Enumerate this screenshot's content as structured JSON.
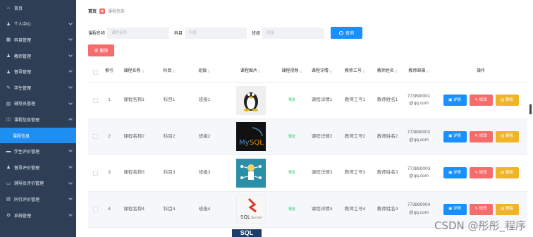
{
  "sidebar": {
    "items": [
      {
        "label": "首页",
        "icon": "home-icon",
        "glyph": "⌂",
        "has_chevron": false,
        "state": "normal"
      },
      {
        "label": "个人中心",
        "icon": "user-icon",
        "glyph": "♟",
        "has_chevron": true,
        "state": "normal"
      },
      {
        "label": "科目管理",
        "icon": "grid-icon",
        "glyph": "▦",
        "has_chevron": true,
        "state": "normal"
      },
      {
        "label": "教师管理",
        "icon": "person-icon",
        "glyph": "♟",
        "has_chevron": true,
        "state": "normal"
      },
      {
        "label": "督导管理",
        "icon": "person-icon",
        "glyph": "♟",
        "has_chevron": true,
        "state": "normal"
      },
      {
        "label": "学生管理",
        "icon": "student-icon",
        "glyph": "✎",
        "has_chevron": true,
        "state": "normal"
      },
      {
        "label": "辅导员管理",
        "icon": "book-icon",
        "glyph": "▤",
        "has_chevron": true,
        "state": "normal"
      },
      {
        "label": "课程信息管理",
        "icon": "folder-icon",
        "glyph": "◫",
        "has_chevron": true,
        "state": "open"
      },
      {
        "label": "课程信息",
        "icon": "",
        "glyph": "",
        "has_chevron": false,
        "state": "active"
      },
      {
        "label": "学生评价管理",
        "icon": "comment-icon",
        "glyph": "▬",
        "has_chevron": true,
        "state": "normal"
      },
      {
        "label": "督导评价管理",
        "icon": "person-icon",
        "glyph": "♟",
        "has_chevron": true,
        "state": "normal"
      },
      {
        "label": "辅导员评价管理",
        "icon": "message-icon",
        "glyph": "▭",
        "has_chevron": true,
        "state": "normal"
      },
      {
        "label": "同行评价管理",
        "icon": "list-icon",
        "glyph": "▤",
        "has_chevron": true,
        "state": "normal"
      },
      {
        "label": "系统管理",
        "icon": "settings-icon",
        "glyph": "⚙",
        "has_chevron": true,
        "state": "normal"
      }
    ]
  },
  "breadcrumb": {
    "home": "首页",
    "current": "课程信息"
  },
  "search": {
    "course_name_label": "课程名称",
    "course_name_placeholder": "课程名称",
    "subject_label": "科目",
    "subject_placeholder": "科目",
    "class_label": "班级",
    "class_placeholder": "班级",
    "button_label": "查询"
  },
  "delete_button": "删除",
  "table": {
    "headers": {
      "index": "索引",
      "name": "课程名称",
      "subject": "科目",
      "class": "班级",
      "image": "课程图片",
      "video": "课程视频",
      "detail": "课程详情",
      "teacher_no": "教师工号",
      "teacher_name": "教师姓名",
      "email": "教师邮箱",
      "actions": "操作"
    },
    "rows": [
      {
        "index": "1",
        "name": "课程名称1",
        "subject": "科目1",
        "class": "班级1",
        "image": "Linux",
        "video": "预览",
        "detail": "课程详情1",
        "teacher_no": "教师工号1",
        "teacher_name": "教师姓名1",
        "email_1": "773890001",
        "email_2": "@qq.com"
      },
      {
        "index": "2",
        "name": "课程名称2",
        "subject": "科目2",
        "class": "班级2",
        "image": "MySQL",
        "video": "预览",
        "detail": "课程详情2",
        "teacher_no": "教师工号2",
        "teacher_name": "教师姓名2",
        "email_1": "773890002",
        "email_2": "@qq.com"
      },
      {
        "index": "3",
        "name": "课程名称3",
        "subject": "科目3",
        "class": "班级3",
        "image": "network",
        "video": "预览",
        "detail": "课程详情3",
        "teacher_no": "教师工号3",
        "teacher_name": "教师姓名3",
        "email_1": "773890003",
        "email_2": "@qq.com"
      },
      {
        "index": "4",
        "name": "课程名称4",
        "subject": "科目4",
        "class": "班级4",
        "image": "SQL Server",
        "video": "预览",
        "detail": "课程详情4",
        "teacher_no": "教师工号4",
        "teacher_name": "教师姓名4",
        "email_1": "773890004",
        "email_2": "@qq.com"
      }
    ],
    "partial_row_image": "SQL"
  },
  "actions": {
    "detail": "详情",
    "edit": "修改",
    "delete": "删除"
  },
  "watermark": "CSDN @彤彤_程序",
  "colors": {
    "sidebar": "#2e3f55",
    "active": "#1f8ef1",
    "primary": "#1890ff",
    "danger": "#f56c6c",
    "warning": "#f0b429"
  }
}
